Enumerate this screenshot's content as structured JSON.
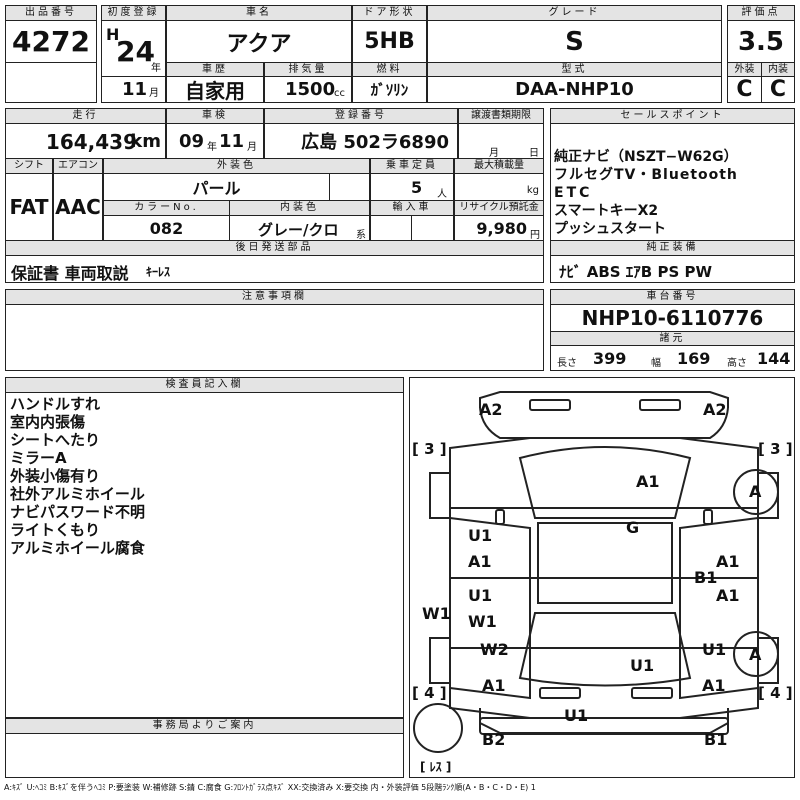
{
  "top": {
    "lot_label": "出品番号",
    "lot_no": "4272",
    "reg_label": "初度登録",
    "era": "H",
    "reg_year": "24",
    "year_unit": "年",
    "reg_month": "11",
    "month_unit": "月",
    "name_label": "車名",
    "name": "アクア",
    "door_label": "ドア形状",
    "door": "5HB",
    "grade_label": "グレード",
    "grade": "S",
    "score_label": "評価点",
    "score": "3.5",
    "history_label": "車歴",
    "history": "自家用",
    "disp_label": "排気量",
    "disp": "1500",
    "disp_unit": "cc",
    "fuel_label": "燃料",
    "fuel": "ｶﾞｿﾘﾝ",
    "model_label": "型式",
    "model": "DAA-NHP10",
    "ext_label": "外装",
    "ext": "C",
    "int_label": "内装",
    "int": "C"
  },
  "row2": {
    "mileage_label": "走行",
    "mileage": "164,439",
    "mileage_unit": "km",
    "inspection_label": "車検",
    "insp_year": "09",
    "insp_year_unit": "年",
    "insp_month": "11",
    "insp_month_unit": "月",
    "plate_label": "登録番号",
    "plate": "広島 502ラ6890",
    "transfer_label": "譲渡書類期限",
    "transfer_month_unit": "月",
    "transfer_day_unit": "日",
    "shift_label": "シフト",
    "shift": "FAT",
    "ac_label": "エアコン",
    "ac": "AAC",
    "color_label": "外装色",
    "color": "パール",
    "capacity_label": "乗車定員",
    "capacity": "5",
    "capacity_unit": "人",
    "load_label": "最大積載量",
    "load_unit": "kg",
    "colorno_label": "カラーNo.",
    "colorno": "082",
    "intcolor_label": "内装色",
    "intcolor": "グレー/クロ",
    "intcolor_unit": "系",
    "import_label": "輸入車",
    "recycle_label": "リサイクル預託金",
    "recycle": "9,980",
    "recycle_unit": "円",
    "later_label": "後日発送部品",
    "later": "保証書 車両取説",
    "later_small": "ｷｰﾚｽ"
  },
  "sales": {
    "label": "セールスポイント",
    "items": [
      "純正ナビ（NSZT−W62G）",
      "フルセグTV・Bluetooth",
      "ETC",
      "スマートキーX2",
      "プッシュスタート"
    ]
  },
  "equip": {
    "label": "純正装備",
    "value": "ﾅﾋﾞ ABS ｴｱB PS PW"
  },
  "notes": {
    "label": "注意事項欄"
  },
  "chassis": {
    "label": "車台番号",
    "value": "NHP10-6110776",
    "dims_label": "諸元",
    "len_label": "長さ",
    "len": "399",
    "wid_label": "幅",
    "wid": "169",
    "hei_label": "高さ",
    "hei": "144"
  },
  "inspector": {
    "label": "検査員記入欄",
    "items": [
      "ハンドルすれ",
      "室内内張傷",
      "シートへたり",
      "ミラーA",
      "外装小傷有り",
      "社外アルミホイール",
      "ナビパスワード不明",
      "ライトくもり",
      "アルミホイール腐食"
    ]
  },
  "office": {
    "label": "事務局よりご案内"
  },
  "diagram": {
    "marks": [
      "A2",
      "A2",
      "[ 3 ]",
      "[ 3 ]",
      "A1",
      "A",
      "G",
      "U1",
      "A1",
      "A1",
      "B1",
      "U1",
      "W1",
      "A1",
      "W1",
      "W2",
      "U1",
      "A",
      "U1",
      "A1",
      "A1",
      "[ 4 ]",
      "[ 4 ]",
      "U1",
      "B2",
      "B1",
      "[ ﾚｽ ]"
    ]
  },
  "footer": "A:ｷｽﾞ U:ﾍｺﾐ B:ｷｽﾞを伴うﾍｺﾐ P:要塗装 W:補修跡 S:錆 C:腐食 G:ﾌﾛﾝﾄｶﾞﾗｽ点ｷｽﾞ XX:交換済み X:要交換 内・外装評価 5段階ﾗﾝｸ順(A・B・C・D・E) 1"
}
